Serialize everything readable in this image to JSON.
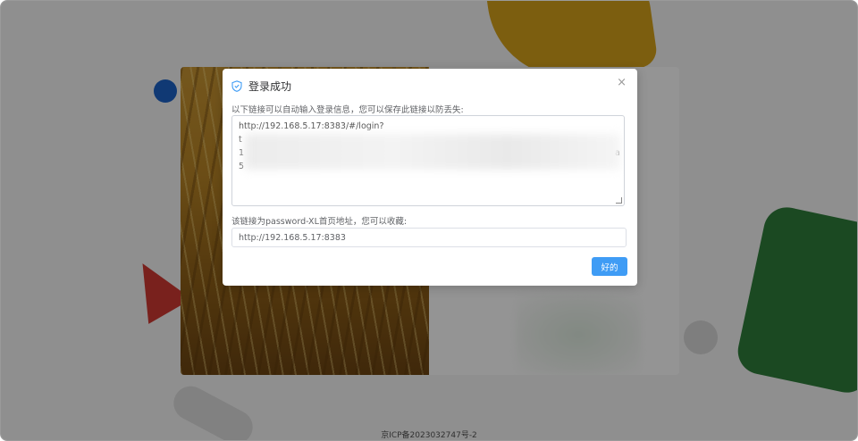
{
  "dialog": {
    "title": "登录成功",
    "close_icon": "×",
    "link_label": "以下链接可以自动输入登录信息，您可以保存此链接以防丢失:",
    "link_value_first_line": "http://192.168.5.17:8383/#/login?",
    "link_value_visible_fragments": [
      "t",
      "1",
      "5",
      "a"
    ],
    "homepage_label": "该链接为password-XL首页地址，您可以收藏:",
    "homepage_value": "http://192.168.5.17:8383",
    "ok_button": "好的"
  },
  "footer": {
    "icp": "京ICP备2023032747号-2"
  },
  "colors": {
    "primary": "#3f9cf5",
    "overlay": "rgba(0,0,0,0.42)"
  },
  "icons": {
    "title_icon": "shield-check-icon",
    "close": "close-icon"
  }
}
